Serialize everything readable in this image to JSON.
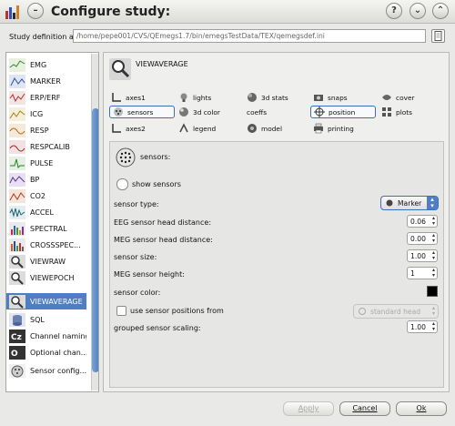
{
  "window": {
    "title": "Configure study:"
  },
  "study": {
    "label": "Study definition at:",
    "path": "/home/pepe001/CVS/QEmegs1.7/bin/emegsTestData/TEX/qemegsdef.ini"
  },
  "left_list": {
    "items": [
      {
        "label": "EMG"
      },
      {
        "label": "MARKER"
      },
      {
        "label": "ERP/ERF"
      },
      {
        "label": "ICG"
      },
      {
        "label": "RESP"
      },
      {
        "label": "RESPCALIB"
      },
      {
        "label": "PULSE"
      },
      {
        "label": "BP"
      },
      {
        "label": "CO2"
      },
      {
        "label": "ACCEL"
      },
      {
        "label": "SPECTRAL"
      },
      {
        "label": "CROSSSPEC..."
      },
      {
        "label": "VIEWRAW"
      },
      {
        "label": "VIEWEPOCH"
      },
      {
        "label": "VIEWAVERAGE"
      },
      {
        "label": "SQL"
      },
      {
        "label": "Channel naming"
      },
      {
        "label": "Optional chan..."
      },
      {
        "label": "Sensor config..."
      }
    ],
    "selected": "VIEWAVERAGE"
  },
  "main": {
    "section_title": "VIEWAVERAGE",
    "tabs": [
      {
        "label": "axes1"
      },
      {
        "label": "lights"
      },
      {
        "label": "3d stats"
      },
      {
        "label": "snaps"
      },
      {
        "label": "cover"
      },
      {
        "label": "sensors"
      },
      {
        "label": "3d color"
      },
      {
        "label": "coeffs"
      },
      {
        "label": "position"
      },
      {
        "label": "plots"
      },
      {
        "label": "axes2"
      },
      {
        "label": "legend"
      },
      {
        "label": "model"
      },
      {
        "label": "printing"
      }
    ],
    "active_tabs": [
      "sensors",
      "position"
    ],
    "sensors": {
      "header": "sensors:",
      "show_sensors_label": "show sensors",
      "sensor_type_label": "sensor type:",
      "sensor_type_value": "Marker",
      "eeg_distance_label": "EEG sensor head distance:",
      "eeg_distance_value": "0.06",
      "meg_distance_label": "MEG sensor head distance:",
      "meg_distance_value": "0.00",
      "sensor_size_label": "sensor size:",
      "sensor_size_value": "1.00",
      "meg_height_label": "MEG sensor height:",
      "meg_height_value": "1",
      "sensor_color_label": "sensor color:",
      "sensor_color": "#000000",
      "use_positions_label": "use sensor positions from",
      "positions_source": "standard head",
      "grouped_scaling_label": "grouped sensor scaling:",
      "grouped_scaling_value": "1.00"
    }
  },
  "buttons": {
    "apply": "Apply",
    "cancel": "Cancel",
    "ok": "Ok"
  },
  "colors": {
    "selection": "#4e7fc3",
    "accent": "#3c6fb6"
  }
}
